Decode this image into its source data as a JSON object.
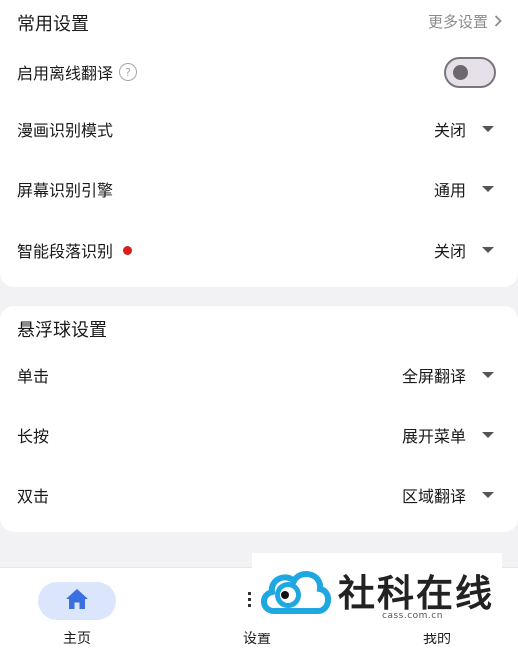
{
  "common_settings": {
    "title": "常用设置",
    "more_link": "更多设置",
    "offline_translate": {
      "label": "启用离线翻译",
      "enabled": false
    },
    "rows": [
      {
        "label": "漫画识别模式",
        "value": "关闭"
      },
      {
        "label": "屏幕识别引擎",
        "value": "通用"
      },
      {
        "label": "智能段落识别",
        "value": "关闭"
      }
    ]
  },
  "float_ball_settings": {
    "title": "悬浮球设置",
    "rows": [
      {
        "label": "单击",
        "value": "全屏翻译"
      },
      {
        "label": "长按",
        "value": "展开菜单"
      },
      {
        "label": "双击",
        "value": "区域翻译"
      }
    ]
  },
  "bottom_nav": {
    "items": [
      {
        "label": "主页",
        "icon": "home-icon",
        "active": true
      },
      {
        "label": "设置",
        "icon": "settings-icon",
        "active": false
      },
      {
        "label": "我的",
        "icon": "profile-icon",
        "active": false
      }
    ]
  },
  "watermark": {
    "text": "社科在线",
    "sub": "cass.com.cn"
  },
  "colors": {
    "accent": "#3a6fe0",
    "active_pill": "#dbe5fb",
    "red_dot": "#d81e1e",
    "secondary_text": "#8c8c8c"
  }
}
